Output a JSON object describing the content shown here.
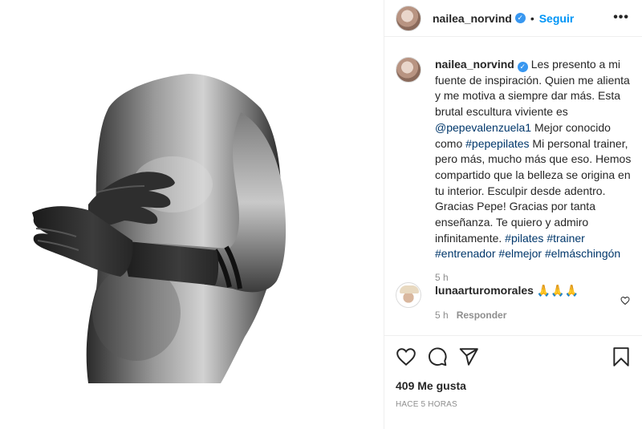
{
  "post": {
    "author": "nailea_norvind",
    "follow_label": "Seguir",
    "separator": "•",
    "more_label": "•••",
    "icons": {
      "verified": "verified-badge-icon",
      "more": "more-options-icon",
      "like": "heart-icon",
      "comment": "comment-icon",
      "share": "share-icon",
      "save": "bookmark-icon",
      "comment_like": "small-heart-icon"
    },
    "colors": {
      "accent": "#0095f6",
      "link": "#00376b",
      "muted": "#8e8e8e",
      "verified": "#3897f0"
    }
  },
  "caption": {
    "author": "nailea_norvind",
    "part1": " Les presento a mi fuente de inspiración. Quien me alienta y me motiva a siempre dar más. Esta brutal escultura viviente es ",
    "mention": "@pepevalenzuela1",
    "part2": " Mejor conocido como ",
    "tag1": "#pepepilates",
    "part3": " Mi personal trainer, pero más, mucho más que eso. Hemos compartido que la belleza se origina en tu interior. Esculpir desde adentro. Gracias Pepe! Gracias por tanta enseñanza. Te quiero y admiro infinitamente. ",
    "tag2": "#pilates",
    "tag3": "#trainer",
    "tag4": "#entrenador",
    "tag5": "#elmejor",
    "tag6": "#elmáschingón",
    "age": "5 h"
  },
  "comment": {
    "author": "lunaarturomorales",
    "text": " 🙏🙏🙏",
    "age": "5 h",
    "reply_label": "Responder"
  },
  "stats": {
    "likes": "409 Me gusta",
    "timestamp": "HACE 5 HORAS"
  }
}
